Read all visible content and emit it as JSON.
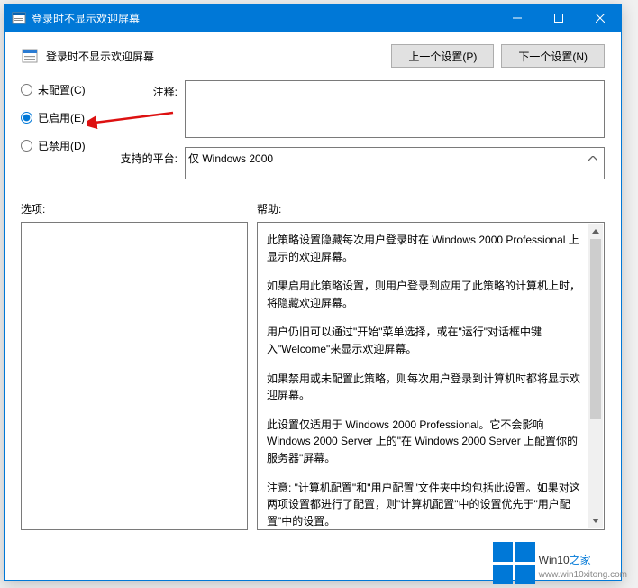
{
  "titlebar": {
    "title": "登录时不显示欢迎屏幕"
  },
  "header": {
    "title": "登录时不显示欢迎屏幕"
  },
  "nav": {
    "prev": "上一个设置(P)",
    "next": "下一个设置(N)"
  },
  "radios": {
    "not_configured": "未配置(C)",
    "enabled": "已启用(E)",
    "disabled": "已禁用(D)"
  },
  "labels": {
    "comment": "注释:",
    "platform": "支持的平台:",
    "options": "选项:",
    "help": "帮助:"
  },
  "platform_value": "仅 Windows 2000",
  "help_text": {
    "p1": "此策略设置隐藏每次用户登录时在 Windows 2000 Professional 上显示的欢迎屏幕。",
    "p2": "如果启用此策略设置，则用户登录到应用了此策略的计算机上时，将隐藏欢迎屏幕。",
    "p3": "用户仍旧可以通过\"开始\"菜单选择，或在\"运行\"对话框中键入\"Welcome\"来显示欢迎屏幕。",
    "p4": "如果禁用或未配置此策略，则每次用户登录到计算机时都将显示欢迎屏幕。",
    "p5": "此设置仅适用于 Windows 2000 Professional。它不会影响 Windows 2000 Server 上的\"在 Windows 2000 Server 上配置你的服务器\"屏幕。",
    "p6": "注意: \"计算机配置\"和\"用户配置\"文件夹中均包括此设置。如果对这两项设置都进行了配置，则\"计算机配置\"中的设置优先于\"用户配置\"中的设置。"
  },
  "watermark": {
    "brand1": "Win10",
    "brand2": "之家",
    "url": "www.win10xitong.com"
  }
}
